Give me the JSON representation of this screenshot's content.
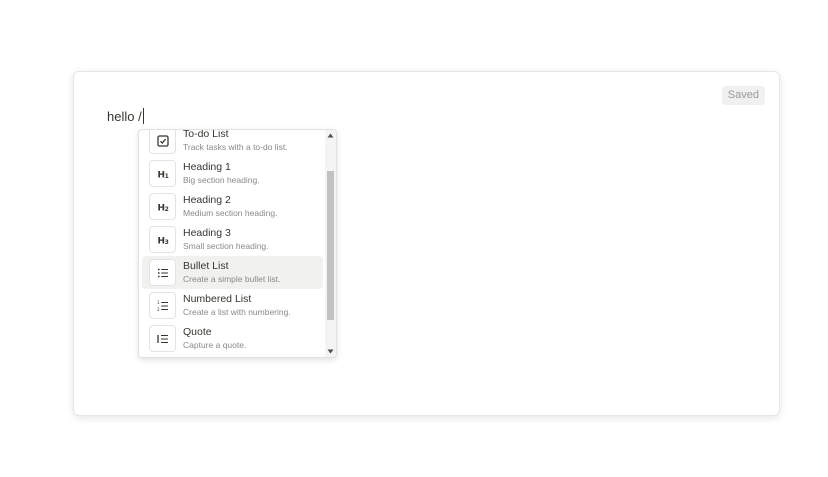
{
  "status": {
    "saved_label": "Saved"
  },
  "editor": {
    "text": "hello /"
  },
  "slash_menu": {
    "items": [
      {
        "title": "To-do List",
        "description": "Track tasks with a to-do list.",
        "icon": "checkbox-icon"
      },
      {
        "title": "Heading 1",
        "description": "Big section heading.",
        "icon": "heading-1-icon"
      },
      {
        "title": "Heading 2",
        "description": "Medium section heading.",
        "icon": "heading-2-icon"
      },
      {
        "title": "Heading 3",
        "description": "Small section heading.",
        "icon": "heading-3-icon"
      },
      {
        "title": "Bullet List",
        "description": "Create a simple bullet list.",
        "icon": "bullet-list-icon"
      },
      {
        "title": "Numbered List",
        "description": "Create a list with numbering.",
        "icon": "numbered-list-icon"
      },
      {
        "title": "Quote",
        "description": "Capture a quote.",
        "icon": "quote-icon"
      }
    ],
    "active_index": 4
  },
  "colors": {
    "text": "#37352f",
    "muted": "#8a8986",
    "active_bg": "#f1f1ef"
  }
}
